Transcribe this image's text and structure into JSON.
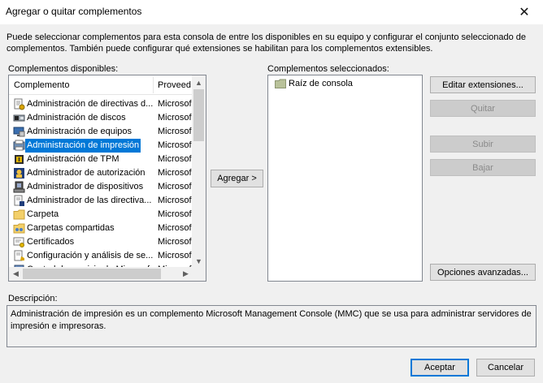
{
  "window": {
    "title": "Agregar o quitar complementos",
    "close_glyph": "✕"
  },
  "intro": {
    "line1": "Puede seleccionar complementos para esta consola de entre los disponibles en su equipo y configurar el conjunto seleccionado de",
    "line2": "complementos. También puede configurar qué extensiones se habilitan para los complementos extensibles."
  },
  "available": {
    "label": "Complementos disponibles:",
    "col_name": "Complemento",
    "col_vendor": "Proveed",
    "items": [
      {
        "name": "Administración de directivas d...",
        "vendor": "Microsof",
        "icon": "policy-icon"
      },
      {
        "name": "Administración de discos",
        "vendor": "Microsof",
        "icon": "disk-icon"
      },
      {
        "name": "Administración de equipos",
        "vendor": "Microsof",
        "icon": "computer-management-icon"
      },
      {
        "name": "Administración de impresión",
        "vendor": "Microsof",
        "icon": "print-management-icon",
        "selected": true
      },
      {
        "name": "Administración de TPM",
        "vendor": "Microsof",
        "icon": "tpm-icon"
      },
      {
        "name": "Administrador de autorización",
        "vendor": "Microsof",
        "icon": "authorization-icon"
      },
      {
        "name": "Administrador de dispositivos",
        "vendor": "Microsof",
        "icon": "device-manager-icon"
      },
      {
        "name": "Administrador de las directiva...",
        "vendor": "Microsof",
        "icon": "policy-editor-icon"
      },
      {
        "name": "Carpeta",
        "vendor": "Microsof",
        "icon": "folder-icon"
      },
      {
        "name": "Carpetas compartidas",
        "vendor": "Microsof",
        "icon": "shared-folders-icon"
      },
      {
        "name": "Certificados",
        "vendor": "Microsof",
        "icon": "certificate-icon"
      },
      {
        "name": "Configuración y análisis de se...",
        "vendor": "Microsof",
        "icon": "security-config-icon"
      },
      {
        "name": "Control de servicio de Microsof...",
        "vendor": "Microsof",
        "icon": "control-icon"
      }
    ]
  },
  "add_button": "Agregar >",
  "selected": {
    "label": "Complementos seleccionados:",
    "root": "Raíz de consola"
  },
  "buttons": {
    "edit_extensions": "Editar extensiones...",
    "remove": "Quitar",
    "move_up": "Subir",
    "move_down": "Bajar",
    "advanced": "Opciones avanzadas...",
    "ok": "Aceptar",
    "cancel": "Cancelar"
  },
  "description": {
    "label": "Descripción:",
    "line1": "Administración de impresión es un complemento Microsoft Management Console (MMC) que se usa para administrar servidores de",
    "line2": "impresión e impresoras."
  },
  "colors": {
    "selection": "#0078d7",
    "window_bg": "#f0f0f0",
    "border": "#828790"
  }
}
